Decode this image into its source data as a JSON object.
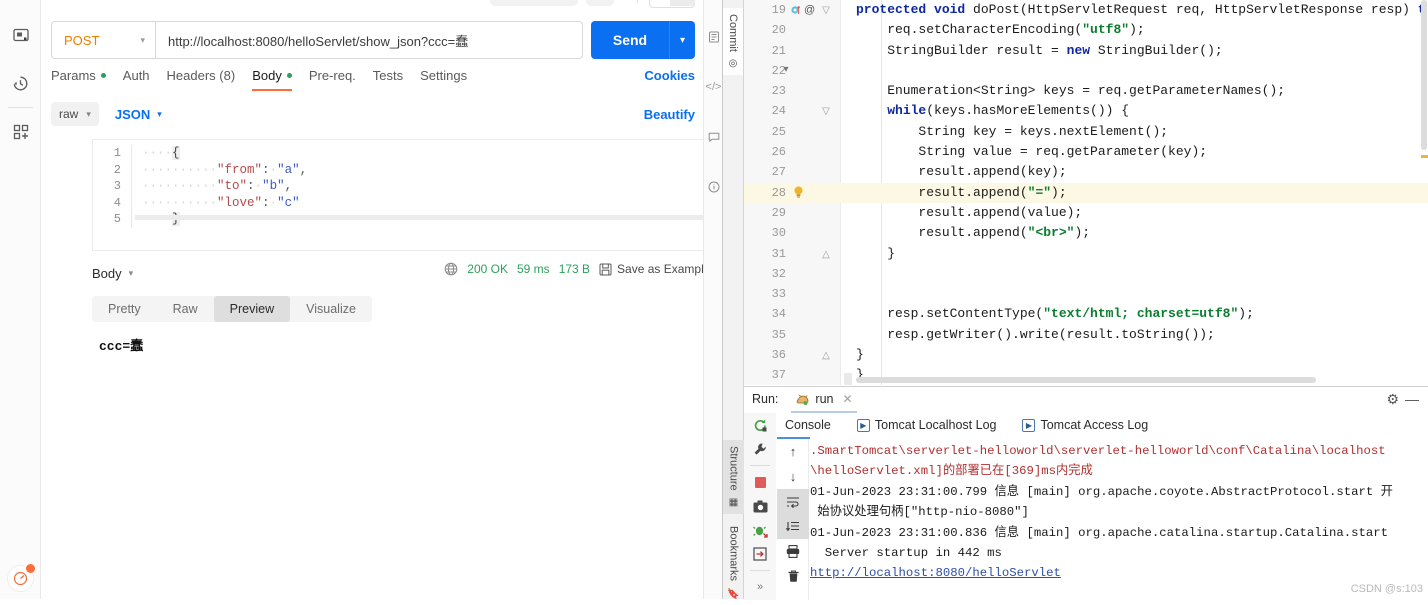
{
  "postman": {
    "left_rail_icons": [
      "collections-icon",
      "history-icon",
      "new-workspace-icon"
    ],
    "right_rail_icons": [
      "documentation-icon",
      "code-snippet-icon",
      "comments-icon",
      "info-icon"
    ],
    "console_button": "console-icon",
    "request": {
      "method": "POST",
      "url": "http://localhost:8080/helloServlet/show_json?ccc=蠢",
      "send_label": "Send",
      "send_caret": "chevron-down-icon"
    },
    "tabs": [
      {
        "label": "Params",
        "dot": true,
        "active": false
      },
      {
        "label": "Auth",
        "dot": false,
        "active": false
      },
      {
        "label": "Headers (8)",
        "dot": false,
        "active": false
      },
      {
        "label": "Body",
        "dot": true,
        "active": true
      },
      {
        "label": "Pre-req.",
        "dot": false,
        "active": false
      },
      {
        "label": "Tests",
        "dot": false,
        "active": false
      },
      {
        "label": "Settings",
        "dot": false,
        "active": false
      }
    ],
    "cookies_label": "Cookies",
    "body_mode": "raw",
    "body_format": "JSON",
    "beautify_label": "Beautify",
    "body_editor": {
      "lines": [
        {
          "no": "1",
          "text": "{"
        },
        {
          "no": "2",
          "text": "    \"from\": \"a\","
        },
        {
          "no": "3",
          "text": "    \"to\": \"b\","
        },
        {
          "no": "4",
          "text": "    \"love\": \"c\""
        },
        {
          "no": "5",
          "text": "}"
        }
      ]
    },
    "response": {
      "body_label": "Body",
      "body_caret": "chevron-down-icon",
      "globe_icon": "globe-icon",
      "status": "200 OK",
      "time": "59 ms",
      "size": "173 B",
      "save_icon": "save-icon",
      "save_label": "Save as Example",
      "more_label": "•••",
      "tabs": [
        "Pretty",
        "Raw",
        "Preview",
        "Visualize"
      ],
      "active_tab": "Preview",
      "preview_text": "ccc=蠢"
    }
  },
  "ide": {
    "rail_tabs": [
      {
        "label": "Commit",
        "icon": "commit-icon"
      },
      {
        "label": "Structure",
        "icon": "structure-icon"
      },
      {
        "label": "Bookmarks",
        "icon": "bookmark-icon"
      }
    ],
    "editor": {
      "lines": [
        {
          "no": "19",
          "code": "protected void doPost(HttpServletRequest req, HttpServletResponse resp) t",
          "keywords": [
            "protected",
            "void"
          ],
          "gutter": "override-and-annotation",
          "fold": true
        },
        {
          "no": "20",
          "code": "    req.setCharacterEncoding(\"utf8\");",
          "strings": [
            "\"utf8\""
          ]
        },
        {
          "no": "21",
          "code": "    StringBuilder result = new StringBuilder();",
          "keywords": [
            "new"
          ]
        },
        {
          "no": "22",
          "code": ""
        },
        {
          "no": "23",
          "code": "    Enumeration<String> keys = req.getParameterNames();"
        },
        {
          "no": "24",
          "code": "    while(keys.hasMoreElements()) {",
          "keywords": [
            "while"
          ],
          "fold": true
        },
        {
          "no": "25",
          "code": "        String key = keys.nextElement();"
        },
        {
          "no": "26",
          "code": "        String value = req.getParameter(key);"
        },
        {
          "no": "27",
          "code": "        result.append(key);"
        },
        {
          "no": "28",
          "code": "        result.append(\"=\");",
          "strings": [
            "\"=\""
          ],
          "highlight": true,
          "gutter": "bulb"
        },
        {
          "no": "29",
          "code": "        result.append(value);"
        },
        {
          "no": "30",
          "code": "        result.append(\"<br>\");",
          "strings": [
            "\"<br>\""
          ]
        },
        {
          "no": "31",
          "code": "    }",
          "fold": true
        },
        {
          "no": "32",
          "code": ""
        },
        {
          "no": "33",
          "code": ""
        },
        {
          "no": "34",
          "code": "    resp.setContentType(\"text/html; charset=utf8\");",
          "strings": [
            "\"text/html; charset=utf8\""
          ]
        },
        {
          "no": "35",
          "code": "    resp.getWriter().write(result.toString());"
        },
        {
          "no": "36",
          "code": "}",
          "fold": true
        },
        {
          "no": "37",
          "code": "}"
        }
      ]
    },
    "run_panel": {
      "title": "Run:",
      "tab_label": "run",
      "tab_icon": "tomcat-icon",
      "tab_close": "close-icon",
      "gear_icon": "gear-icon",
      "minimize_icon": "minimize-icon",
      "toolbar_icons": [
        "rerun-icon",
        "wrench-icon",
        "stop-icon",
        "camera-icon",
        "debug-icon",
        "export-icon",
        "expand-icon"
      ],
      "console_toolbar_icons": [
        "arrow-up-icon",
        "arrow-down-icon",
        "soft-wrap-icon",
        "scroll-to-end-icon",
        "print-icon",
        "trash-icon"
      ],
      "subtabs": [
        {
          "label": "Console",
          "active": true,
          "icon": null
        },
        {
          "label": "Tomcat Localhost Log",
          "active": false,
          "icon": "play-icon"
        },
        {
          "label": "Tomcat Access Log",
          "active": false,
          "icon": "play-icon"
        }
      ],
      "console_lines": [
        {
          "text": ".SmartTomcat\\serverlet-helloworld\\serverlet-helloworld\\conf\\Catalina\\localhost",
          "style": "red"
        },
        {
          "text": "\\helloServlet.xml]的部署已在[369]ms内完成",
          "style": "red"
        },
        {
          "text": "01-Jun-2023 23:31:00.799 信息 [main] org.apache.coyote.AbstractProtocol.start 开",
          "style": "normal"
        },
        {
          "text": " 始协议处理句柄[\"http-nio-8080\"]",
          "style": "normal"
        },
        {
          "text": "01-Jun-2023 23:31:00.836 信息 [main] org.apache.catalina.startup.Catalina.start",
          "style": "normal"
        },
        {
          "text": "  Server startup in 442 ms",
          "style": "normal"
        },
        {
          "text": "http://localhost:8080/helloServlet",
          "style": "link"
        }
      ]
    },
    "watermark": "CSDN @s:103"
  }
}
